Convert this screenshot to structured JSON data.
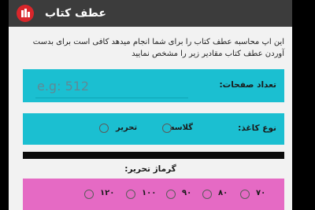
{
  "app_bar": {
    "title": "عطف کتاب",
    "icon": "app-logo-icon"
  },
  "intro_text": "این اپ محاسبه عطف کتاب را برای شما انجام میدهد کافی است برای بدست آوردن عطف کتاب مقادیر زیر را مشخص نمایید",
  "pages": {
    "label": "تعداد صفحات:",
    "placeholder": "e.g: 512",
    "value": ""
  },
  "paper_type": {
    "label": "نوع کاغذ:",
    "options": [
      "گلاسه",
      "تحریر"
    ],
    "selected": null
  },
  "font_weight": {
    "title": "گرماژ تحریر:",
    "options": [
      "۷۰",
      "۸۰",
      "۹۰",
      "۱۰۰",
      "۱۲۰"
    ],
    "selected": null
  },
  "colors": {
    "app_bar": "#3c3c3c",
    "logo": "#d9262b",
    "cyan_card": "#1bbfd1",
    "pink_card": "#e56ac4"
  }
}
